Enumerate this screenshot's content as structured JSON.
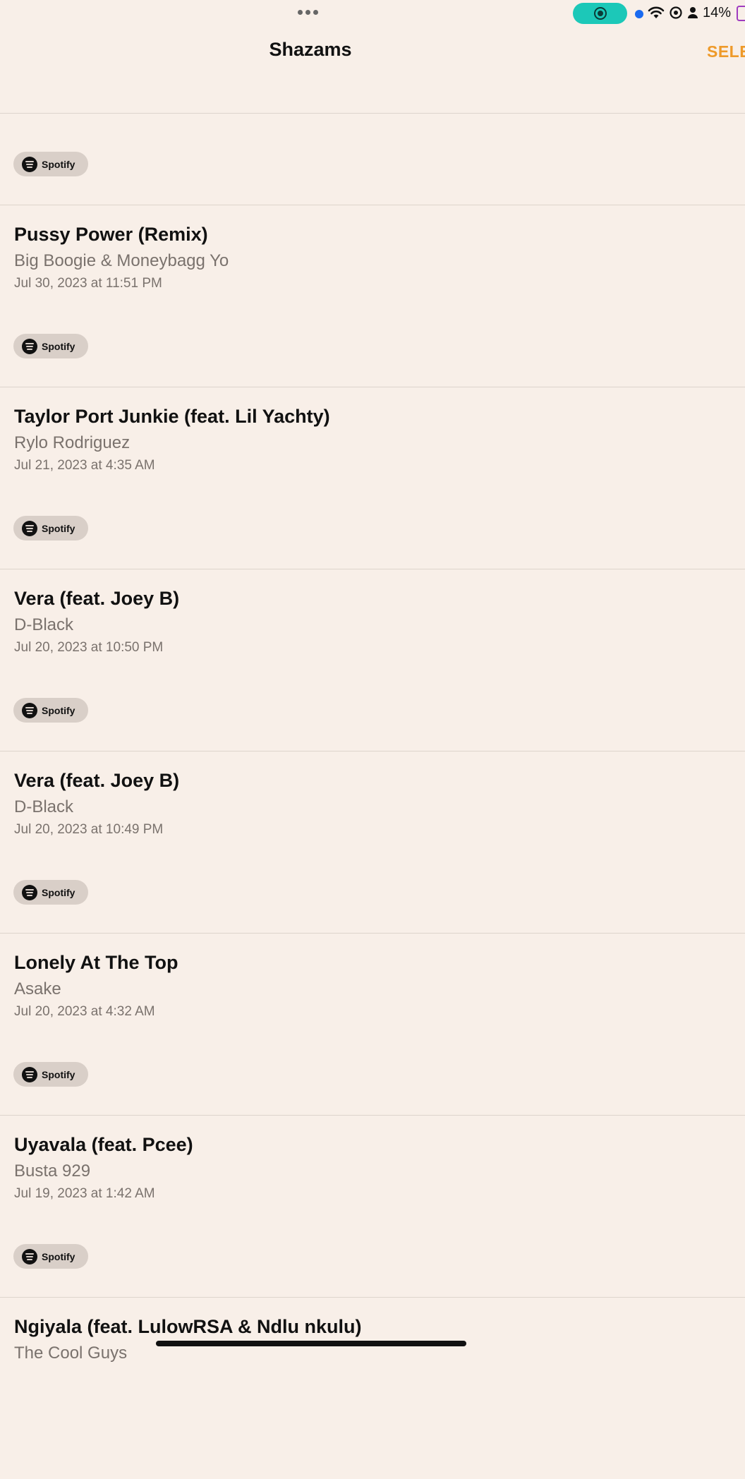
{
  "status_bar": {
    "battery": "14%",
    "icons": [
      "more-dots-icon",
      "screen-record-icon",
      "location-dot-icon",
      "wifi-icon",
      "vpn-icon",
      "person-icon",
      "battery-icon"
    ]
  },
  "header": {
    "title": "Shazams",
    "select_label": "SELE"
  },
  "first_badge": {
    "label": "Spotify"
  },
  "items": [
    {
      "song": "Pussy Power (Remix)",
      "artist": "Big Boogie & Moneybagg Yo",
      "date": "Jul 30, 2023 at 11:51 PM",
      "badge": "Spotify"
    },
    {
      "song": "Taylor Port Junkie (feat. Lil Yachty)",
      "artist": "Rylo Rodriguez",
      "date": "Jul 21, 2023 at 4:35 AM",
      "badge": "Spotify"
    },
    {
      "song": "Vera (feat. Joey B)",
      "artist": "D-Black",
      "date": "Jul 20, 2023 at 10:50 PM",
      "badge": "Spotify"
    },
    {
      "song": "Vera (feat. Joey B)",
      "artist": "D-Black",
      "date": "Jul 20, 2023 at 10:49 PM",
      "badge": "Spotify"
    },
    {
      "song": "Lonely At The Top",
      "artist": "Asake",
      "date": "Jul 20, 2023 at 4:32 AM",
      "badge": "Spotify"
    },
    {
      "song": "Uyavala (feat. Pcee)",
      "artist": "Busta 929",
      "date": "Jul 19, 2023 at 1:42 AM",
      "badge": "Spotify"
    },
    {
      "song": "Ngiyala (feat. LulowRSA & Ndlu nkulu)",
      "artist": "The Cool Guys",
      "date": "",
      "badge": ""
    }
  ],
  "colors": {
    "background": "#f8efe8",
    "accent": "#ee9a2a",
    "record_pill": "#1cc8b8",
    "badge_bg": "#d9cfc8"
  }
}
